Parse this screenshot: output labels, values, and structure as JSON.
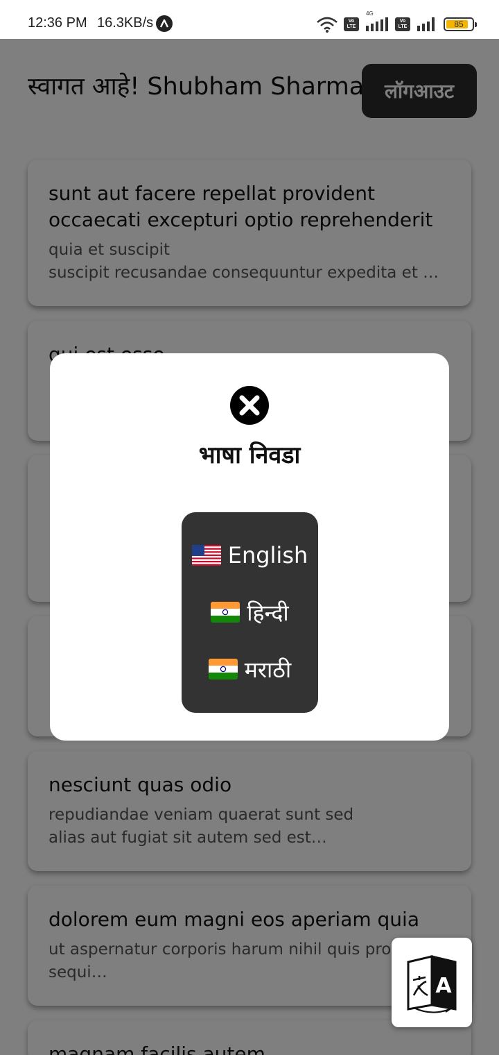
{
  "status_bar": {
    "time": "12:36 PM",
    "net_speed": "16.3KB/s",
    "network_badge": "4G",
    "volte_label": "Vo LTE",
    "battery_level": "85",
    "battery_fraction": 0.85,
    "icons": [
      "app-notification-icon",
      "wifi-icon",
      "volte-icon",
      "signal-icon",
      "battery-icon"
    ]
  },
  "header": {
    "welcome_text": "स्वागत आहे! Shubham Sharma",
    "logout_label": "लॉगआउट"
  },
  "posts": [
    {
      "title": "sunt aut facere repellat provident occaecati excepturi optio reprehenderit",
      "body": "quia et suscipit\nsuscipit recusandae consequuntur expedita et …"
    },
    {
      "title": "qui est esse",
      "body": ""
    },
    {
      "title": "",
      "body": ""
    },
    {
      "title": "",
      "body": ""
    },
    {
      "title": "nesciunt quas odio",
      "body": "repudiandae veniam quaerat sunt sed\nalias aut fugiat sit autem sed est…"
    },
    {
      "title": "dolorem eum magni eos aperiam quia",
      "body": "ut aspernatur corporis harum nihil quis pro\nsequi…"
    },
    {
      "title": "magnam facilis autem",
      "body": ""
    }
  ],
  "language_modal": {
    "title": "भाषा निवडा",
    "options": [
      {
        "flag": "us-flag-icon",
        "label": "English"
      },
      {
        "flag": "india-flag-icon",
        "label": "हिन्दी"
      },
      {
        "flag": "india-flag-icon",
        "label": "मराठी"
      }
    ]
  },
  "colors": {
    "overlay": "#000000",
    "logout_bg": "#2a2a2a",
    "lang_box_bg": "#333333",
    "battery_fill": "#f4b400"
  },
  "fab": {
    "icon": "translate-icon"
  }
}
